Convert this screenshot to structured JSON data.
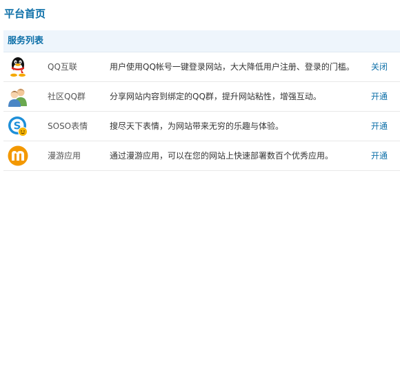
{
  "page": {
    "title": "平台首页"
  },
  "panel": {
    "title": "服务列表",
    "services": [
      {
        "icon": "qq-penguin-icon",
        "name": "QQ互联",
        "description": "用户使用QQ帐号一键登录网站，大大降低用户注册、登录的门槛。",
        "action": "关闭"
      },
      {
        "icon": "qq-group-icon",
        "name": "社区QQ群",
        "description": "分享网站内容到绑定的QQ群，提升网站粘性，增强互动。",
        "action": "开通"
      },
      {
        "icon": "soso-emoticon-icon",
        "name": "SOSO表情",
        "description": "搜尽天下表情，为网站带来无穷的乐趣与体验。",
        "action": "开通"
      },
      {
        "icon": "manyou-app-icon",
        "name": "漫游应用",
        "description": "通过漫游应用，可以在您的网站上快速部署数百个优秀应用。",
        "action": "开通"
      }
    ]
  }
}
